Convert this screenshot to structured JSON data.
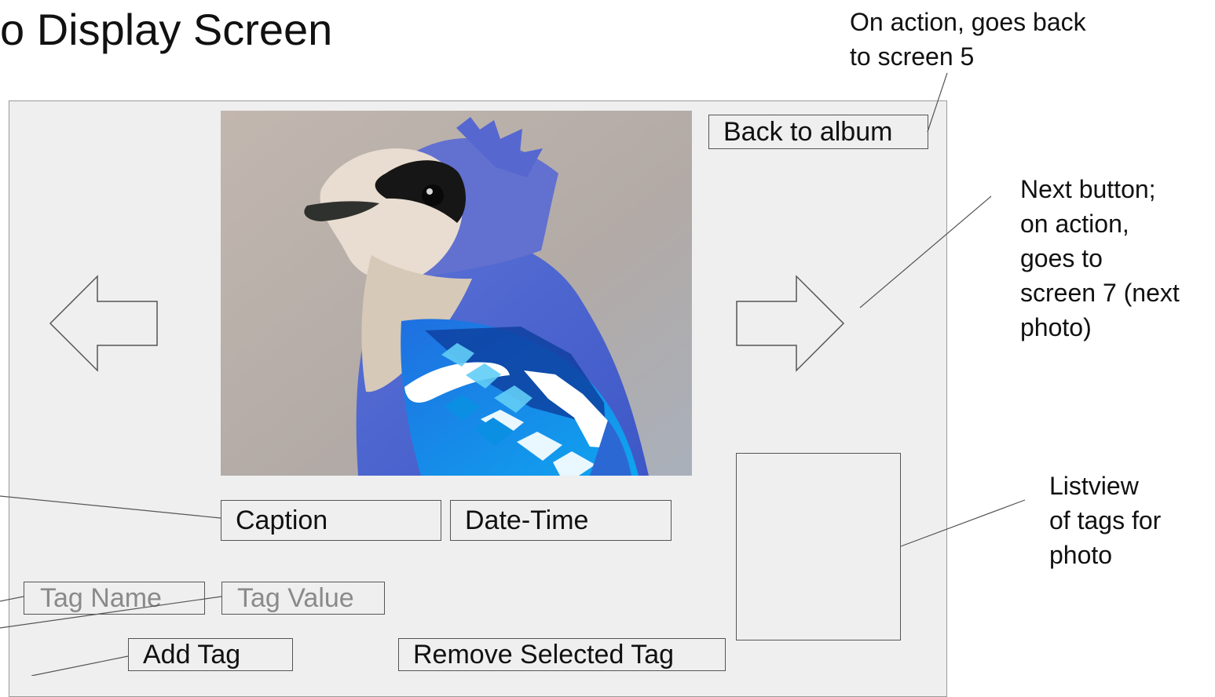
{
  "title": "o Display Screen",
  "annotations": {
    "back_note": [
      "On action, goes back",
      "to screen 5"
    ],
    "next_note": [
      "Next button;",
      "on action,",
      "goes to",
      "screen 7 (next",
      "photo)"
    ],
    "list_note": [
      "Listview",
      "of tags for",
      "photo"
    ]
  },
  "buttons": {
    "back": "Back to album",
    "add_tag": "Add Tag",
    "remove_tag": "Remove Selected Tag"
  },
  "fields": {
    "caption": "Caption",
    "date_time": "Date-Time",
    "tag_name_placeholder": "Tag Name",
    "tag_value_placeholder": "Tag Value"
  },
  "icons": {
    "prev": "left-arrow-icon",
    "next": "right-arrow-icon"
  },
  "colors": {
    "panel": "#efefef",
    "border": "#555555"
  }
}
